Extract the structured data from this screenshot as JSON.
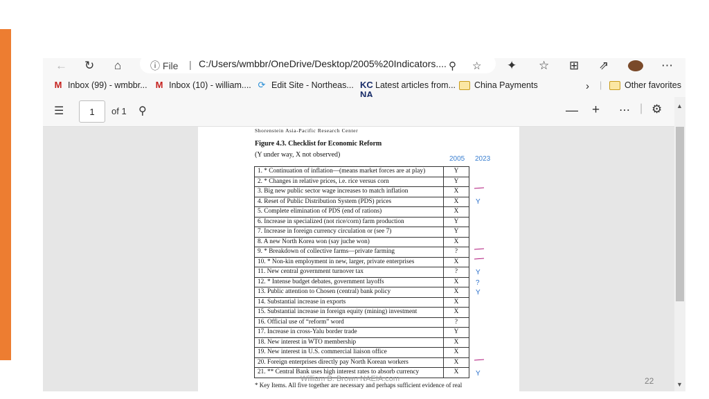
{
  "browser": {
    "nav": {
      "address": "C:/Users/wmbbr/OneDrive/Desktop/2005%20Indicators....",
      "scheme_label": "File"
    },
    "favorites": [
      {
        "label": "Inbox (99) - wmbbr...",
        "icon": "gmail-icon"
      },
      {
        "label": "Inbox (10) - william....",
        "icon": "gmail-icon"
      },
      {
        "label": "Edit Site - Northeas...",
        "icon": "site-icon"
      },
      {
        "label": "Latest articles from...",
        "icon": "kcna-icon"
      },
      {
        "label": "China Payments",
        "icon": "folder-icon"
      }
    ],
    "other_favorites": "Other favorites",
    "kcna_badge": "KC\nNA"
  },
  "pdf": {
    "page_number": "1",
    "page_total": "of 1"
  },
  "document": {
    "header": "Shorenstein Asia-Pacific Research Center",
    "figure_title": "Figure 4.3. Checklist for Economic Reform",
    "figure_subtitle": "(Y under way, X not observed)",
    "year_2005": "2005",
    "year_2023": "2023",
    "rows": [
      {
        "item": "1.  * Continuation of inflation—(means market forces are at play)",
        "mark": "Y",
        "y2023": "",
        "dash": false
      },
      {
        "item": "2.  * Changes in relative prices, i.e. rice versus corn",
        "mark": "Y",
        "y2023": "",
        "dash": false
      },
      {
        "item": "3.  Big new public sector wage increases to match inflation",
        "mark": "X",
        "y2023": "",
        "dash": true
      },
      {
        "item": "4.  Reset of Public Distribution System (PDS) prices",
        "mark": "X",
        "y2023": "Y",
        "dash": false
      },
      {
        "item": "5.  Complete elimination of PDS (end of rations)",
        "mark": "X",
        "y2023": "",
        "dash": false
      },
      {
        "item": "6.  Increase in specialized  (not rice/corn) farm production",
        "mark": "Y",
        "y2023": "",
        "dash": false
      },
      {
        "item": "7.  Increase in foreign currency circulation or (see 7)",
        "mark": "Y",
        "y2023": "",
        "dash": false
      },
      {
        "item": "8.  A new North Korea won (say juche won)",
        "mark": "X",
        "y2023": "",
        "dash": false
      },
      {
        "item": "9.  * Breakdown of collective farms—private farming",
        "mark": "?",
        "y2023": "",
        "dash": true
      },
      {
        "item": "10. * Non-kin employment in new, larger, private enterprises",
        "mark": "X",
        "y2023": "",
        "dash": true
      },
      {
        "item": "11. New central government turnover tax",
        "mark": "?",
        "y2023": "Y",
        "dash": false
      },
      {
        "item": "12. * Intense budget debates, government layoffs",
        "mark": "X",
        "y2023": "?",
        "dash": false
      },
      {
        "item": "13. Public attention to Chosen (central) bank policy",
        "mark": "X",
        "y2023": "Y",
        "dash": false
      },
      {
        "item": "14. Substantial increase in exports",
        "mark": "X",
        "y2023": "",
        "dash": false
      },
      {
        "item": "15. Substantial increase in foreign equity (mining) investment",
        "mark": "X",
        "y2023": "",
        "dash": false
      },
      {
        "item": "16. Official use of “reform” word",
        "mark": "?",
        "y2023": "",
        "dash": false
      },
      {
        "item": "17. Increase in cross-Yalu border trade",
        "mark": "Y",
        "y2023": "",
        "dash": false
      },
      {
        "item": "18. New interest in WTO membership",
        "mark": "X",
        "y2023": "",
        "dash": false
      },
      {
        "item": "19. New interest in U.S. commercial liaison office",
        "mark": "X",
        "y2023": "",
        "dash": false
      },
      {
        "item": "20. Foreign enterprises directly pay North Korean workers",
        "mark": "X",
        "y2023": "",
        "dash": true
      },
      {
        "item": "21. ** Central Bank uses high interest rates to absorb currency",
        "mark": "X",
        "y2023": "Y",
        "dash": false
      }
    ],
    "footnote": "* Key Items. All five together are necessary and perhaps sufficient evidence of real"
  },
  "watermark": "William B. Brown  NAEIA.com",
  "slide_number": "22",
  "colors": {
    "accent": "#ed7d31",
    "year_label": "#3a7fd0",
    "annotation_dash": "#b0177a"
  }
}
